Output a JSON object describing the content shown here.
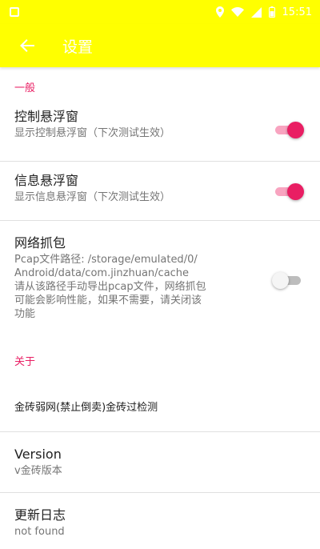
{
  "status_bar": {
    "time": "15:51",
    "icons": [
      "app-notification-icon",
      "location-icon",
      "wifi-icon",
      "signal-icon",
      "battery-icon"
    ]
  },
  "app_bar": {
    "title": "设置",
    "back_icon": "arrow-left-icon"
  },
  "sections": {
    "general": {
      "header": "一般",
      "floating_control": {
        "title": "控制悬浮窗",
        "summary": "显示控制悬浮窗（下次测试生效）",
        "enabled": true
      },
      "floating_info": {
        "title": "信息悬浮窗",
        "summary": "显示信息悬浮窗（下次测试生效）",
        "enabled": true
      },
      "packet_capture": {
        "title": "网络抓包",
        "summary": "Pcap文件路径: /storage/emulated/0/\nAndroid/data/com.jinzhuan/cache\n请从该路径手动导出pcap文件，网络抓包\n可能会影响性能，如果不需要，请关闭该\n功能",
        "enabled": false
      }
    },
    "about": {
      "header": "关于",
      "app_info": "金砖弱网(禁止倒卖)金砖过检测",
      "version": {
        "title": "Version",
        "summary": "v金砖版本"
      },
      "changelog": {
        "title": "更新日志",
        "summary": "not found"
      }
    }
  },
  "colors": {
    "toolbar": "#ffff00",
    "accent": "#e91e63",
    "switch_on_track": "#f8a4c0",
    "switch_off_track": "#bdbdbd",
    "divider": "#e0e0e0"
  }
}
